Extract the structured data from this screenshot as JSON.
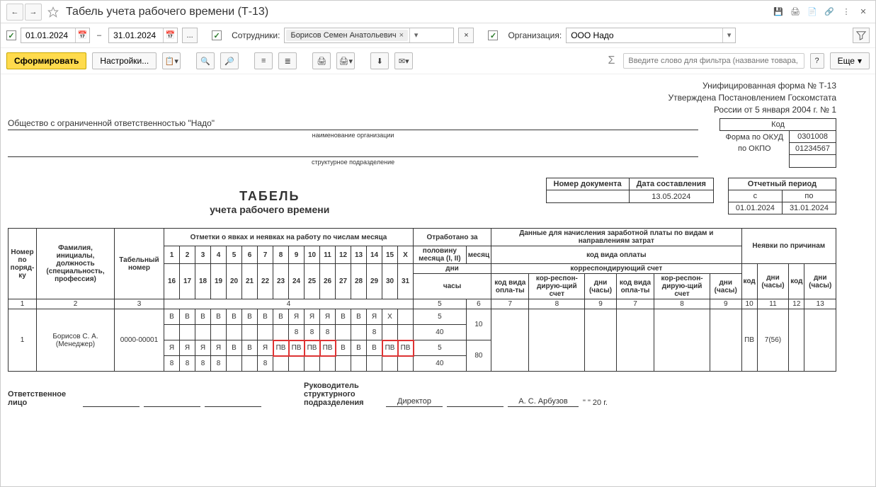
{
  "window": {
    "title": "Табель учета рабочего времени (Т-13)"
  },
  "toolbar1": {
    "date_from": "01.01.2024",
    "date_to": "31.01.2024",
    "dots": "...",
    "employees_label": "Сотрудники:",
    "employee_token": "Борисов Семен Анатольевич",
    "org_label": "Организация:",
    "org_value": "ООО Надо"
  },
  "toolbar2": {
    "generate": "Сформировать",
    "settings": "Настройки...",
    "search_placeholder": "Введите слово для фильтра (название товара, покупателя ...",
    "more": "Еще"
  },
  "report": {
    "form_line1": "Унифицированная форма № Т-13",
    "form_line2": "Утверждена Постановлением Госкомстата",
    "form_line3": "России от 5 января 2004 г. № 1",
    "codes": {
      "head": "Код",
      "okud_label": "Форма по ОКУД",
      "okud": "0301008",
      "okpo_label": "по ОКПО",
      "okpo": "01234567"
    },
    "org_name": "Общество с ограниченной ответственностью \"Надо\"",
    "org_caption": "наименование организации",
    "subdiv_caption": "структурное подразделение",
    "doc_num_label": "Номер документа",
    "doc_date_label": "Дата составления",
    "doc_date": "13.05.2024",
    "period_label": "Отчетный период",
    "period_from_label": "с",
    "period_to_label": "по",
    "period_from": "01.01.2024",
    "period_to": "31.01.2024",
    "title": "ТАБЕЛЬ",
    "subtitle": "учета  рабочего  времени",
    "headers": {
      "num": "Номер по поряд-ку",
      "fio": "Фамилия, инициалы, должность (специальность, профессия)",
      "tabnum": "Табельный номер",
      "marks": "Отметки о явках и неявках на работу по числам месяца",
      "worked": "Отработано за",
      "half": "половину месяца (I, II)",
      "month": "месяц",
      "days": "дни",
      "hours": "часы",
      "payroll": "Данные для начисления заработной платы по видам и направлениям затрат",
      "pay_code": "код вида оплаты",
      "corr_acct": "корреспондирующий счет",
      "days_hours": "дни (часы)",
      "pay_code_short": "код вида опла-ты",
      "corr_short": "кор-респон-дирую-щий счет",
      "absence": "Неявки по причинам",
      "code": "код"
    },
    "colnums": [
      "1",
      "2",
      "3",
      "4",
      "5",
      "6",
      "7",
      "8",
      "9",
      "10",
      "11",
      "12",
      "13"
    ],
    "days1": [
      "1",
      "2",
      "3",
      "4",
      "5",
      "6",
      "7",
      "8",
      "9",
      "10",
      "11",
      "12",
      "13",
      "14",
      "15",
      "X"
    ],
    "days2": [
      "16",
      "17",
      "18",
      "19",
      "20",
      "21",
      "22",
      "23",
      "24",
      "25",
      "26",
      "27",
      "28",
      "29",
      "30",
      "31"
    ],
    "row": {
      "num": "1",
      "fio": "Борисов С. А. (Менеджер)",
      "tabnum": "0000-00001",
      "marks1": [
        "В",
        "В",
        "В",
        "В",
        "В",
        "В",
        "В",
        "В",
        "Я",
        "Я",
        "Я",
        "В",
        "В",
        "Я",
        "X"
      ],
      "hours1": [
        "",
        "",
        "",
        "",
        "",
        "",
        "",
        "",
        "8",
        "8",
        "8",
        "",
        "",
        "8",
        ""
      ],
      "marks2": [
        "Я",
        "Я",
        "Я",
        "Я",
        "В",
        "В",
        "Я",
        "ПВ",
        "ПВ",
        "ПВ",
        "ПВ",
        "В",
        "В",
        "В",
        "ПВ",
        "ПВ"
      ],
      "hours2": [
        "8",
        "8",
        "8",
        "8",
        "",
        "",
        "8",
        "",
        "",
        "",
        "",
        "",
        "",
        "",
        "",
        ""
      ],
      "red_idx2": [
        7,
        8,
        9,
        10,
        14,
        15
      ],
      "worked_days": [
        "5",
        "5"
      ],
      "worked_hours": [
        "40",
        "40"
      ],
      "month_days": "10",
      "month_hours": "80",
      "abs_code": "ПВ",
      "abs_days": "7(56)"
    },
    "footer": {
      "resp": "Ответственное лицо",
      "head_label": "Руководитель структурного подразделения",
      "head_pos": "Директор",
      "head_name": "А. С. Арбузов",
      "date_tail": "\"     \"                     20    г."
    }
  }
}
